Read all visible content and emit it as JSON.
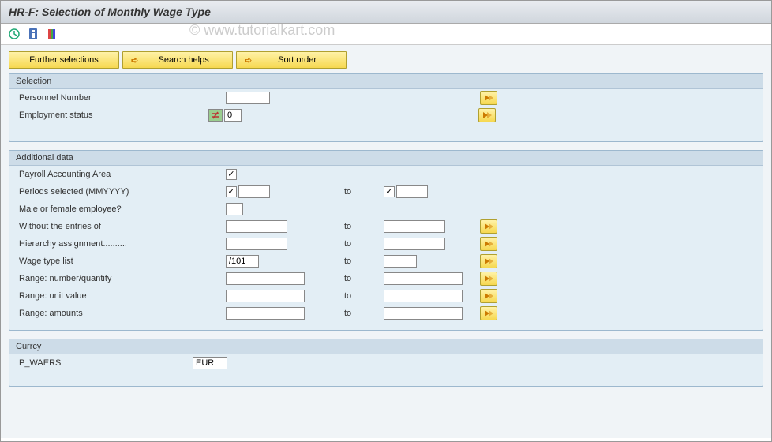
{
  "title": "HR-F: Selection of Monthly Wage Type",
  "watermark": "© www.tutorialkart.com",
  "buttons": {
    "further_selections": "Further selections",
    "search_helps": "Search helps",
    "sort_order": "Sort order"
  },
  "selection": {
    "title": "Selection",
    "personnel_number_label": "Personnel Number",
    "personnel_number_value": "",
    "employment_status_label": "Employment status",
    "employment_status_value": "0"
  },
  "additional": {
    "title": "Additional data",
    "payroll_area_label": "Payroll Accounting Area",
    "periods_label": "Periods selected (MMYYYY)",
    "periods_from": "",
    "periods_to": "",
    "to_label": "to",
    "gender_label": "Male or female employee?",
    "gender_value": "",
    "without_entries_label": "Without the entries of",
    "without_entries_from": "",
    "without_entries_to": "",
    "hierarchy_label": "Hierarchy assignment..........",
    "hierarchy_from": "",
    "hierarchy_to": "",
    "wage_type_label": "Wage type list",
    "wage_type_from": "/101",
    "wage_type_to": "",
    "range_qty_label": "Range: number/quantity",
    "range_qty_from": "",
    "range_qty_to": "",
    "range_unit_label": "Range: unit value",
    "range_unit_from": "",
    "range_unit_to": "",
    "range_amt_label": "Range: amounts",
    "range_amt_from": "",
    "range_amt_to": ""
  },
  "currency": {
    "title": "Currcy",
    "p_waers_label": "P_WAERS",
    "p_waers_value": "EUR"
  },
  "checkmark": "✓"
}
